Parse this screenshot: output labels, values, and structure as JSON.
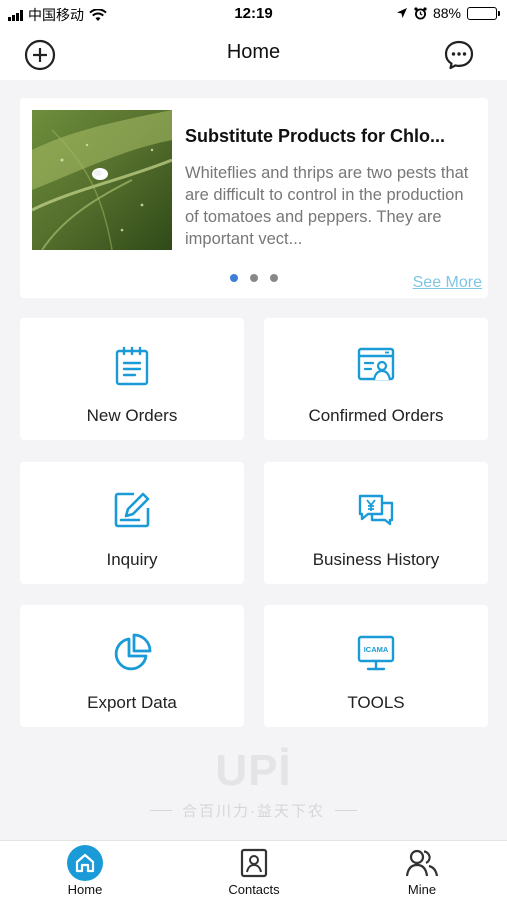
{
  "status_bar": {
    "carrier": "中国移动",
    "time": "12:19",
    "battery": "88%",
    "battery_level": 0.88
  },
  "header": {
    "title": "Home",
    "left_icon": "add-circle-icon",
    "right_icon": "chat-bubble-icon"
  },
  "banner": {
    "title": "Substitute Products for Chlo...",
    "description": "Whiteflies and thrips are two pests that are difficult to control in the production of tomatoes and peppers. They are important vect...",
    "see_more": "See More",
    "image": "leaf-with-whitefly-photo",
    "slides": 3,
    "active_slide": 1
  },
  "menu": [
    {
      "label": "New Orders",
      "icon": "clipboard-list-icon"
    },
    {
      "label": "Confirmed Orders",
      "icon": "browser-user-icon"
    },
    {
      "label": "Inquiry",
      "icon": "edit-pencil-icon"
    },
    {
      "label": "Business History",
      "icon": "yen-chat-icon"
    },
    {
      "label": "Export Data",
      "icon": "pie-chart-icon"
    },
    {
      "label": "TOOLS",
      "icon": "icama-monitor-icon"
    }
  ],
  "monitor_text": "ICAMA",
  "brand": {
    "logo": "UPİ",
    "slogan": "合百川力·益天下农"
  },
  "tabbar": [
    {
      "label": "Home",
      "icon": "home-icon",
      "active": true
    },
    {
      "label": "Contacts",
      "icon": "contacts-icon",
      "active": false
    },
    {
      "label": "Mine",
      "icon": "users-icon",
      "active": false
    }
  ],
  "colors": {
    "accent": "#1a9bd8",
    "tab_active": "#1a9bd8",
    "link": "#7ec6e4",
    "dot_active": "#3d7fd6"
  }
}
